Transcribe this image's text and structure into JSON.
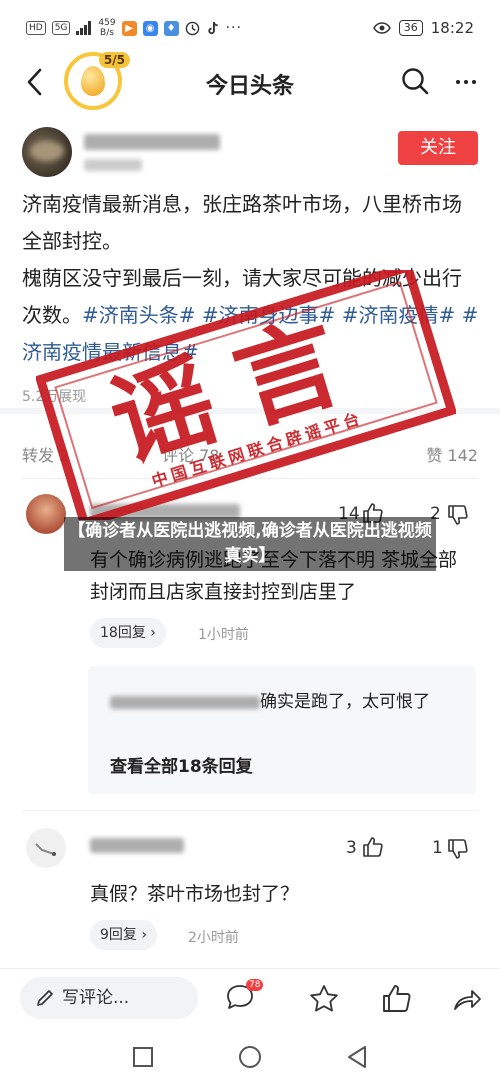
{
  "status_bar": {
    "left_tags": [
      "HD",
      "5G"
    ],
    "net_speed_value": "459",
    "net_speed_unit": "B/s",
    "battery": "36",
    "time": "18:22"
  },
  "header": {
    "title": "今日头条",
    "coin_progress": "5/5"
  },
  "post": {
    "follow_label": "关注",
    "text_line1": "济南疫情最新消息，张庄路茶叶市场，八里桥市场全部封控。",
    "text_line2_plain": "槐荫区没守到最后一刻，请大家尽可能的减少出行次数。",
    "hashtags": "#济南头条# #济南身边事# #济南疫情# #济南疫情最新信息#",
    "views": "5.2万展现",
    "shares": "转发 2",
    "comments": "评论 78",
    "likes": "赞 142"
  },
  "comments": [
    {
      "text": "有个确诊病例逃跑了至今下落不明 茶城全部封闭而且店家直接封控到店里了",
      "likes": "14",
      "dislikes": "2",
      "reply_count": "18回复",
      "time": "1小时前",
      "reply_preview": "确实是跑了，太可恨了",
      "view_all": "查看全部18条回复"
    },
    {
      "text": "真假？茶叶市场也封了？",
      "likes": "3",
      "dislikes": "1",
      "reply_count": "9回复",
      "time": "2小时前"
    }
  ],
  "bottom_bar": {
    "comment_placeholder": "写评论...",
    "comment_badge": "78"
  },
  "overlay": {
    "stamp_text": "谣言",
    "stamp_org": "中国互联网联合辟谣平台",
    "caption": "【确诊者从医院出逃视频,确诊者从医院出逃视频真实】"
  },
  "colors": {
    "accent_red": "#f04142",
    "hashtag_blue": "#2f5c96",
    "stamp_red": "#c6181e"
  }
}
